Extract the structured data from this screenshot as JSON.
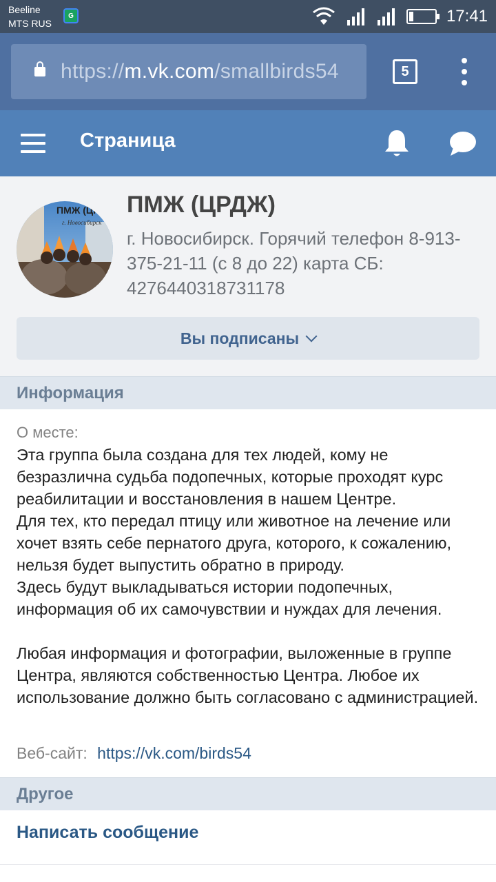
{
  "status_bar": {
    "carrier1": "Beeline",
    "carrier2": "MTS RUS",
    "app_badge": "G",
    "time": "17:41",
    "battery_level": 0.18
  },
  "browser": {
    "url_scheme": "https://",
    "url_host": "m.vk.com",
    "url_path": "/smallbirds54",
    "tab_count": "5"
  },
  "header": {
    "title": "Страница"
  },
  "profile": {
    "name": "ПМЖ (ЦРДЖ)",
    "status": "г. Новосибирск. Горячий телефон 8-913-375-21-11 (с 8 до 22) карта СБ: 4276440318731178",
    "avatar_text1": "ПМЖ (ЦР",
    "avatar_text2": "г. Новосибирск",
    "subscribe_label": "Вы подписаны"
  },
  "info_section": {
    "title": "Информация",
    "about_label": "О месте:",
    "description": "Эта группа была создана для тех людей, кому не безразлична судьба подопечных, которые проходят курс реабилитации и восстановления в нашем Центре.\nДля тех, кто передал птицу или животное на лечение или хочет взять себе пернатого друга, которого, к сожалению, нельзя будет выпустить обратно в природу.\nЗдесь будут выкладываться истории подопечных, информация об их самочувствии и нуждах для лечения.\n\nЛюбая информация и фотографии, выложенные в группе Центра, являются собственностью Центра. Любое их использование должно быть согласовано с администрацией.",
    "website_label": "Веб-сайт:",
    "website_value": "https://vk.com/birds54"
  },
  "other_section": {
    "title": "Другое",
    "write_message": "Написать сообщение"
  },
  "colors": {
    "status_bar": "#3f4f63",
    "browser_bar": "#4f70a1",
    "vk_header": "#5181b8",
    "link": "#2a5885"
  }
}
